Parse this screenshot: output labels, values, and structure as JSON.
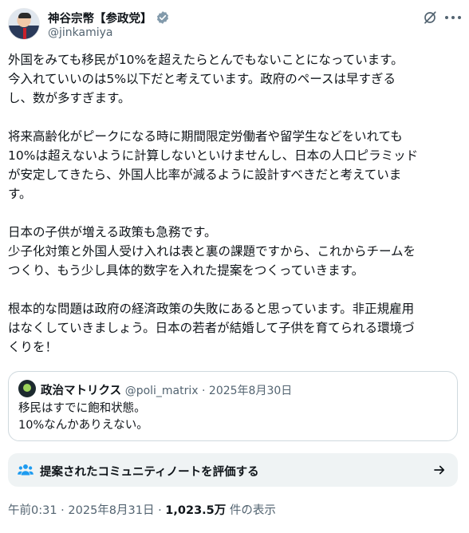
{
  "author": {
    "name": "神谷宗幣【参政党】",
    "handle": "@jinkamiya",
    "verified_color": "#829aab"
  },
  "post": {
    "paragraphs": [
      [
        "外国をみても移民が10%を超えたらとんでもないことになっています。",
        "今入れていいのは5%以下だと考えています。政府のペースは早すぎる",
        "し、数が多すぎます。"
      ],
      [
        "将来高齢化がピークになる時に期間限定労働者や留学生などをいれても",
        "10%は超えないように計算しないといけませんし、日本の人口ピラミッド",
        "が安定してきたら、外国人比率が減るように設計すべきだと考えていま",
        "す。"
      ],
      [
        "日本の子供が増える政策も急務です。",
        "少子化対策と外国人受け入れは表と裏の課題ですから、これからチームを",
        "つくり、もう少し具体的数字を入れた提案をつくっていきます。"
      ],
      [
        "根本的な問題は政府の経済政策の失敗にあると思っています。非正規雇用",
        "はなくしていきましょう。日本の若者が結婚して子供を育てられる環境づ",
        "くりを！"
      ]
    ]
  },
  "quote": {
    "name": "政治マトリクス",
    "handle": "@poli_matrix",
    "date": "2025年8月30日",
    "lines": [
      "移民はすでに飽和状態。",
      "10%なんかありえない。"
    ]
  },
  "community_note": {
    "label": "提案されたコミュニティノートを評価する",
    "icon_color": "#1d9bf0"
  },
  "footer": {
    "time": "午前0:31",
    "date": "2025年8月31日",
    "views": "1,023.5万",
    "views_suffix": "件の表示"
  }
}
